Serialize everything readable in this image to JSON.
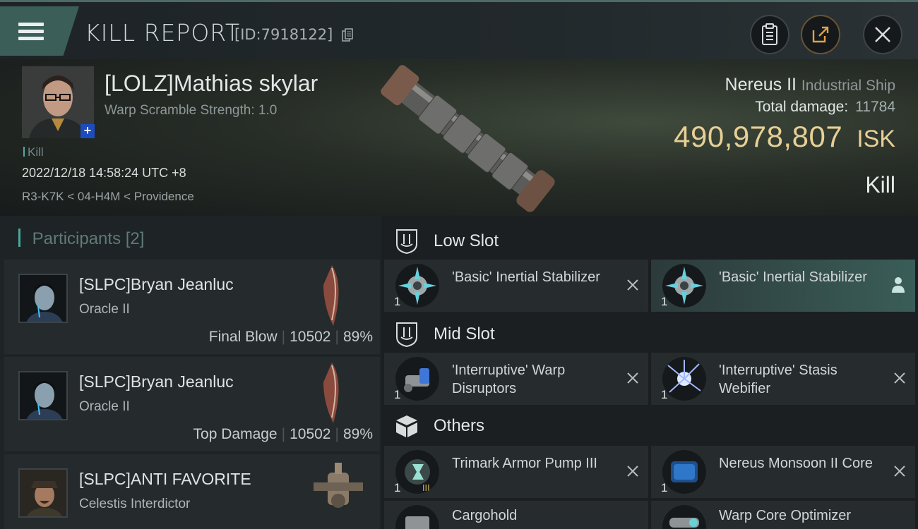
{
  "header": {
    "title": "KILL REPORT",
    "report_id": "[ID:7918122]",
    "icons": [
      "menu-icon",
      "clipboard-icon",
      "share-icon",
      "close-icon",
      "copy-icon"
    ]
  },
  "victim": {
    "name": "[LOLZ]Mathias skylar",
    "warp_scramble": "Warp Scramble Strength: 1.0",
    "kill_tag": "Kill",
    "datetime": "2022/12/18 14:58:24 UTC +8",
    "location": "R3-K7K < 04-H4M < Providence",
    "ship_name": "Nereus II",
    "ship_class": "Industrial Ship",
    "total_damage_label": "Total damage:",
    "total_damage": "11784",
    "isk_value": "490,978,807",
    "isk_unit": "ISK",
    "result": "Kill",
    "plus_badge": "+"
  },
  "participants": {
    "title": "Participants",
    "count": "[2]",
    "items": [
      {
        "name": "[SLPC]Bryan Jeanluc",
        "ship": "Oracle II",
        "tag": "Final Blow",
        "damage": "10502",
        "percent": "89%"
      },
      {
        "name": "[SLPC]Bryan Jeanluc",
        "ship": "Oracle II",
        "tag": "Top Damage",
        "damage": "10502",
        "percent": "89%"
      },
      {
        "name": "[SLPC]ANTI FAVORITE",
        "ship": "Celestis Interdictor"
      }
    ]
  },
  "fitting": {
    "low_slot": {
      "label": "Low Slot",
      "items": [
        {
          "name": "'Basic' Inertial Stabilizer",
          "qty": "1"
        },
        {
          "name": "'Basic' Inertial Stabilizer",
          "qty": "1"
        }
      ]
    },
    "mid_slot": {
      "label": "Mid Slot",
      "items": [
        {
          "name": "'Interruptive' Warp Disruptors",
          "qty": "1"
        },
        {
          "name": "'Interruptive' Stasis Webifier",
          "qty": "1"
        }
      ]
    },
    "others": {
      "label": "Others",
      "items": [
        {
          "name": "Trimark Armor Pump III",
          "qty": "1"
        },
        {
          "name": "Nereus Monsoon II Core",
          "qty": "1"
        },
        {
          "name": "Cargohold",
          "qty": ""
        },
        {
          "name": "Warp Core Optimizer",
          "qty": ""
        }
      ]
    }
  },
  "colors": {
    "accent": "#4aa79b",
    "isk_gold": "#e7cf96",
    "menu_bg": "#3b5e59",
    "highlight": "#3a5d58"
  }
}
